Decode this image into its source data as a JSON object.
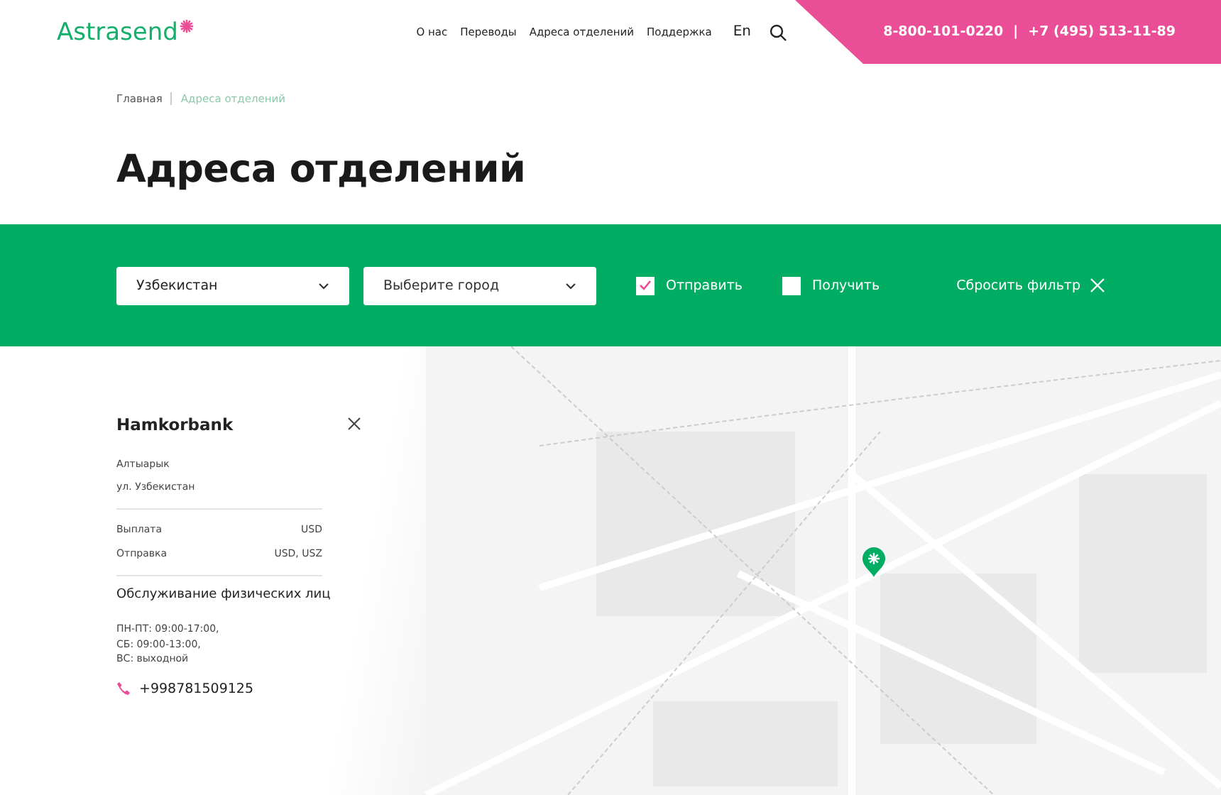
{
  "header": {
    "logo": "Astrasend",
    "nav": [
      "О нас",
      "Переводы",
      "Адреса отделений",
      "Поддержка"
    ],
    "language": "En",
    "phones": [
      "8-800-101-0220",
      "|",
      "+7 (495) 513-11-89"
    ]
  },
  "breadcrumbs": [
    {
      "label": "Главная",
      "selected": false
    },
    {
      "label": "Адреса отделений",
      "selected": true
    }
  ],
  "title": "Адреса отделений",
  "filters": {
    "country": "Узбекистан",
    "city_placeholder": "Выберите город",
    "checkboxes": [
      {
        "label": "Отправить",
        "checked": true
      },
      {
        "label": "Получить",
        "checked": false
      }
    ],
    "reset": "Сбросить фильтр"
  },
  "office": {
    "name": "Hamkorbank",
    "address": [
      "Алтыарык",
      "ул. Узбекистан"
    ],
    "currencies": [
      {
        "label": "Выплата",
        "value": "USD"
      },
      {
        "label": "Отправка",
        "value": "USD, USZ"
      }
    ],
    "service_title": "Обслуживание физических лиц",
    "hours": [
      "ПН-ПТ: 09:00-17:00,",
      "СБ: 09:00-13:00,",
      "ВС: выходной"
    ],
    "phone": "+998781509125"
  }
}
